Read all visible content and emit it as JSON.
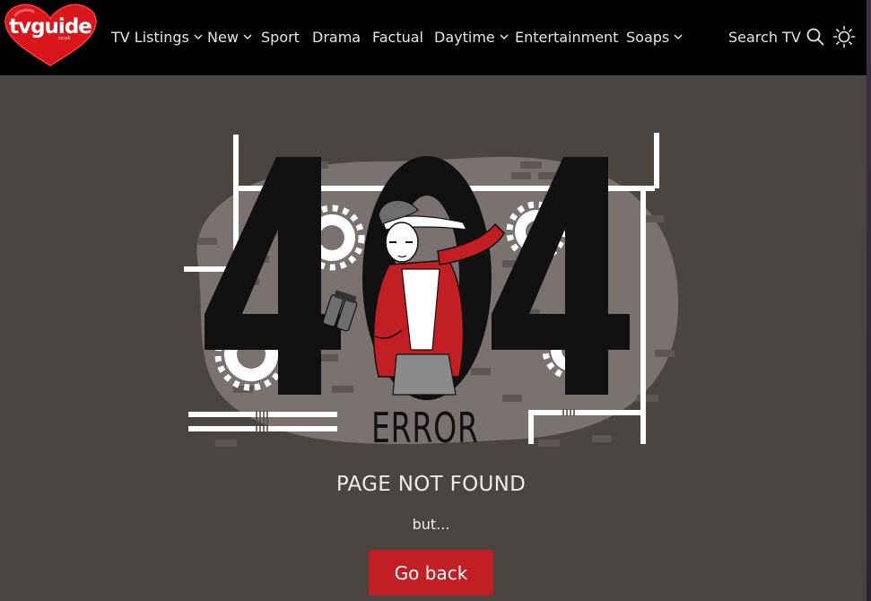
{
  "header": {
    "logo_text": "tvguide",
    "logo_sub": "co.uk",
    "nav": [
      {
        "label": "TV Listings",
        "has_dropdown": true
      },
      {
        "label": "New",
        "has_dropdown": true
      },
      {
        "label": "Sport",
        "has_dropdown": false
      },
      {
        "label": "Drama",
        "has_dropdown": false
      },
      {
        "label": "Factual",
        "has_dropdown": false
      },
      {
        "label": "Daytime",
        "has_dropdown": true
      },
      {
        "label": "Entertainment",
        "has_dropdown": false
      },
      {
        "label": "Soaps",
        "has_dropdown": true
      }
    ],
    "search_label": "Search TV",
    "search_icon": "search-icon",
    "theme_icon": "sun-icon"
  },
  "illustration": {
    "digits": "404",
    "error_label": "ERROR"
  },
  "main": {
    "title": "PAGE NOT FOUND",
    "subtitle": "but...",
    "button_label": "Go back"
  },
  "colors": {
    "background": "#4a4541",
    "header": "#000000",
    "accent": "#c21f24",
    "blob": "#7a7270"
  }
}
